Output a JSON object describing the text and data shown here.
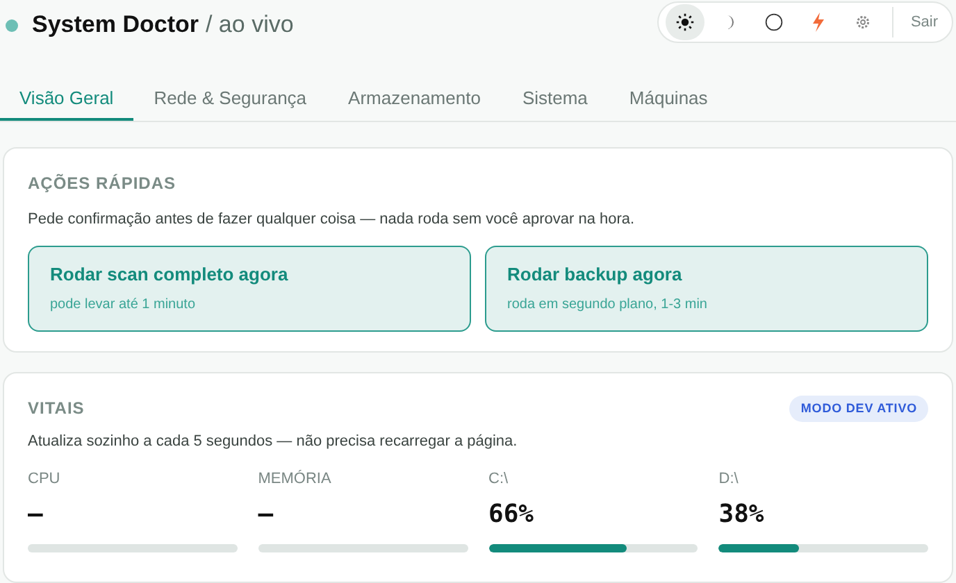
{
  "header": {
    "title": "System Doctor",
    "subtitle": "/ ao vivo",
    "theme_buttons": [
      {
        "kind": "sun",
        "selected": true
      },
      {
        "kind": "moon",
        "selected": false
      },
      {
        "kind": "circle",
        "selected": false
      },
      {
        "kind": "bolt",
        "selected": false
      },
      {
        "kind": "gear",
        "selected": false
      }
    ],
    "logout": "Sair"
  },
  "tabs": [
    {
      "label": "Visão Geral",
      "selected": true
    },
    {
      "label": "Rede & Segurança",
      "selected": false
    },
    {
      "label": "Armazenamento",
      "selected": false
    },
    {
      "label": "Sistema",
      "selected": false
    },
    {
      "label": "Máquinas",
      "selected": false
    }
  ],
  "quick_actions": {
    "heading": "AÇÕES RÁPIDAS",
    "description": "Pede confirmação antes de fazer qualquer coisa — nada roda sem você aprovar na hora.",
    "actions": [
      {
        "title": "Rodar scan completo agora",
        "hint": "pode levar até 1 minuto"
      },
      {
        "title": "Rodar backup agora",
        "hint": "roda em segundo plano, 1-3 min"
      }
    ]
  },
  "vitals": {
    "heading": "VITAIS",
    "badge": "MODO DEV ATIVO",
    "description": "Atualiza sozinho a cada 5 segundos — não precisa recarregar a página.",
    "metrics": [
      {
        "label": "CPU",
        "value": "–"
      },
      {
        "label": "MEMÓRIA",
        "value": "–"
      },
      {
        "label": "C:\\",
        "value": "66%",
        "level": 0.66
      },
      {
        "label": "D:\\",
        "value": "38%",
        "level": 0.38
      }
    ]
  }
}
